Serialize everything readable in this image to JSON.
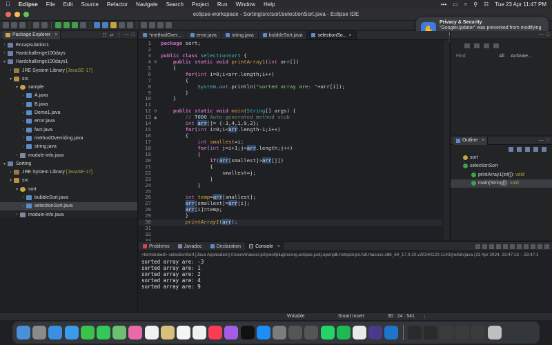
{
  "menubar": {
    "app_name": "Eclipse",
    "items": [
      "File",
      "Edit",
      "Source",
      "Refactor",
      "Navigate",
      "Search",
      "Project",
      "Run",
      "Window",
      "Help"
    ],
    "datetime": "Tue 23 Apr  11:47 PM"
  },
  "window": {
    "title": "eclipse-workspace - Sorting/src/sort/selectionSort.java - Eclipse IDE"
  },
  "package_explorer": {
    "tab_label": "Package Explorer",
    "rows": [
      {
        "label": "Encapsulation1",
        "arrow": ">",
        "icon": "project-icon",
        "indent": 0
      },
      {
        "label": "Hardchallenge100days",
        "arrow": ">",
        "icon": "project-icon",
        "indent": 0
      },
      {
        "label": "Hardchallenge100days1",
        "arrow": "v",
        "icon": "project-icon",
        "indent": 0
      },
      {
        "label": "JRE System Library",
        "tag": "[JavaSE-17]",
        "arrow": ">",
        "icon": "library-icon",
        "indent": 1
      },
      {
        "label": "src",
        "arrow": "v",
        "icon": "source-folder-icon",
        "indent": 1
      },
      {
        "label": "sample",
        "arrow": "v",
        "icon": "package-icon",
        "indent": 2
      },
      {
        "label": "A.java",
        "arrow": ">",
        "icon": "java-file-icon",
        "indent": 3
      },
      {
        "label": "B.java",
        "arrow": ">",
        "icon": "java-file-icon",
        "indent": 3
      },
      {
        "label": "Demo1.java",
        "arrow": ">",
        "icon": "java-file-icon",
        "indent": 3
      },
      {
        "label": "error.java",
        "arrow": ">",
        "icon": "java-file-icon",
        "indent": 3
      },
      {
        "label": "fact.java",
        "arrow": ">",
        "icon": "java-file-icon",
        "indent": 3
      },
      {
        "label": "methodOverriding.java",
        "arrow": ">",
        "icon": "java-file-icon",
        "indent": 3
      },
      {
        "label": "string.java",
        "arrow": ">",
        "icon": "java-file-icon",
        "indent": 3
      },
      {
        "label": "module-info.java",
        "arrow": ">",
        "icon": "module-icon",
        "indent": 2
      },
      {
        "label": "Sorting",
        "arrow": "v",
        "icon": "project-icon",
        "indent": 0
      },
      {
        "label": "JRE System Library",
        "tag": "[JavaSE-17]",
        "arrow": ">",
        "icon": "library-icon",
        "indent": 1
      },
      {
        "label": "src",
        "arrow": "v",
        "icon": "source-folder-icon",
        "indent": 1
      },
      {
        "label": "sort",
        "arrow": "v",
        "icon": "package-icon",
        "indent": 2
      },
      {
        "label": "bubbleSort.java",
        "arrow": ">",
        "icon": "java-file-icon",
        "indent": 3
      },
      {
        "label": "selectionSort.java",
        "arrow": ">",
        "icon": "java-file-icon",
        "indent": 3,
        "selected": true
      },
      {
        "label": "module-info.java",
        "arrow": ">",
        "icon": "module-icon",
        "indent": 2
      }
    ]
  },
  "editor": {
    "tabs": [
      "*methodOver...",
      "error.java",
      "string.java",
      "bubbleSort.java",
      "selectionSo..."
    ],
    "active_tab_index": 4,
    "lines": [
      {
        "n": "1",
        "html": "<span class=\"kw\">package</span> sort;"
      },
      {
        "n": "2",
        "html": ""
      },
      {
        "n": "3",
        "html": "<span class=\"kw\">public class</span> <span class=\"cls\">selectionSort</span> {"
      },
      {
        "n": "4",
        "mark": "⊖",
        "html": "    <span class=\"kw\">public static void</span> <span class=\"mth\">printArray1</span>(<span class=\"ty\">int</span> arr[])"
      },
      {
        "n": "5",
        "html": "    {"
      },
      {
        "n": "6",
        "html": "        <span class=\"kw\">for</span>(<span class=\"ty\">int</span> i=0;i&lt;arr.length;i++)"
      },
      {
        "n": "7",
        "html": "        {"
      },
      {
        "n": "8",
        "html": "            <span class=\"cls\">System</span>.<span class=\"fld\">out</span>.println(<span class=\"str\">\"sorted array are: \"</span>+arr[i]);"
      },
      {
        "n": "9",
        "html": "        }"
      },
      {
        "n": "10",
        "html": "    }"
      },
      {
        "n": "11",
        "html": ""
      },
      {
        "n": "12",
        "mark": "⊖",
        "html": "    <span class=\"kw\">public static void</span> <span class=\"mth\">main</span>(<span class=\"cls\">String</span>[] args) {"
      },
      {
        "n": "13",
        "mark": "▲",
        "html": "        <span class=\"cmt\">// </span><span class=\"todo\">TODO</span><span class=\"cmt\"> Auto-generated method stub</span>"
      },
      {
        "n": "14",
        "html": "        <span class=\"ty\">int</span> <span class=\"hl\">arr</span>[]= {-3,4,1,9,2};"
      },
      {
        "n": "15",
        "html": "        <span class=\"kw\">for</span>(<span class=\"ty\">int</span> i=0;i&lt;<span class=\"hl\">arr</span>.length-1;i++)"
      },
      {
        "n": "16",
        "html": "        {"
      },
      {
        "n": "17",
        "html": "            <span class=\"ty\">int</span> <span class=\"var\">smallest</span>=i;"
      },
      {
        "n": "18",
        "html": "            <span class=\"kw\">for</span>(<span class=\"ty\">int</span> j=i+1;j&lt;<span class=\"hl\">arr</span>.length;j++)"
      },
      {
        "n": "19",
        "html": "            {"
      },
      {
        "n": "20",
        "html": "                <span class=\"kw\">if</span>(<span class=\"hl\">arr</span>[smallest]&gt;<span class=\"hl\">arr</span>[j])"
      },
      {
        "n": "21",
        "html": "                {"
      },
      {
        "n": "22",
        "html": "                    smallest=j;"
      },
      {
        "n": "23",
        "html": "                }"
      },
      {
        "n": "24",
        "html": "            }"
      },
      {
        "n": "25",
        "html": ""
      },
      {
        "n": "26",
        "html": "        <span class=\"ty\">int</span> <span class=\"var\">temp</span>=<span class=\"hl\">arr</span>[smallest];"
      },
      {
        "n": "27",
        "html": "        <span class=\"hl\">arr</span>[smallest]=<span class=\"hl\">arr</span>[i];"
      },
      {
        "n": "28",
        "html": "        <span class=\"hl\">arr</span>[i]=temp;"
      },
      {
        "n": "29",
        "html": "        }"
      },
      {
        "n": "30",
        "cur": true,
        "html": "        <span class=\"mth\" style=\"font-style:italic\">printArray1</span>(<span class=\"hl\">arr</span>);"
      },
      {
        "n": "31",
        "html": ""
      },
      {
        "n": "32",
        "html": ""
      },
      {
        "n": "33",
        "html": ""
      }
    ]
  },
  "task_list": {
    "filter_placeholder": "Find",
    "all_label": "All",
    "activate_label": "Activate..."
  },
  "outline": {
    "tab_label": "Outline",
    "rows": [
      {
        "label": "sort",
        "indent": 0,
        "icon": "package-icon"
      },
      {
        "label": "selectionSort",
        "indent": 0,
        "icon": "class-icon"
      },
      {
        "label": "printArray1(int[])",
        "suffix": " : void",
        "indent": 1,
        "icon": "method-icon"
      },
      {
        "label": "main(String[])",
        "suffix": " : void",
        "indent": 1,
        "icon": "method-icon",
        "selected": true
      }
    ]
  },
  "notification": {
    "title": "Privacy & Security",
    "body": "“GoogleUpdater” was prevented from modifying apps on your Mac."
  },
  "console": {
    "tabs": [
      "Problems",
      "Javadoc",
      "Declaration",
      "Console"
    ],
    "active_tab_index": 3,
    "terminated_line": "<terminated> selectionSort [Java Application] /Users/macos/.p2/pool/plugins/org.eclipse.justj.openjdk.hotspot.jre.full.macosx.x86_64_17.0.10.v20240120-1143/jre/bin/java  (23 Apr 2024, 23:47:13 – 23:47:1",
    "output": [
      "sorted array are: -3",
      "sorted array are: 1",
      "sorted array are: 2",
      "sorted array are: 4",
      "sorted array are: 9"
    ]
  },
  "status": {
    "writable": "Writable",
    "insert_mode": "Smart Insert",
    "position": "30 : 24 : 541"
  },
  "colors": {
    "accent": "#3d7be0",
    "background": "#1e1f22"
  }
}
